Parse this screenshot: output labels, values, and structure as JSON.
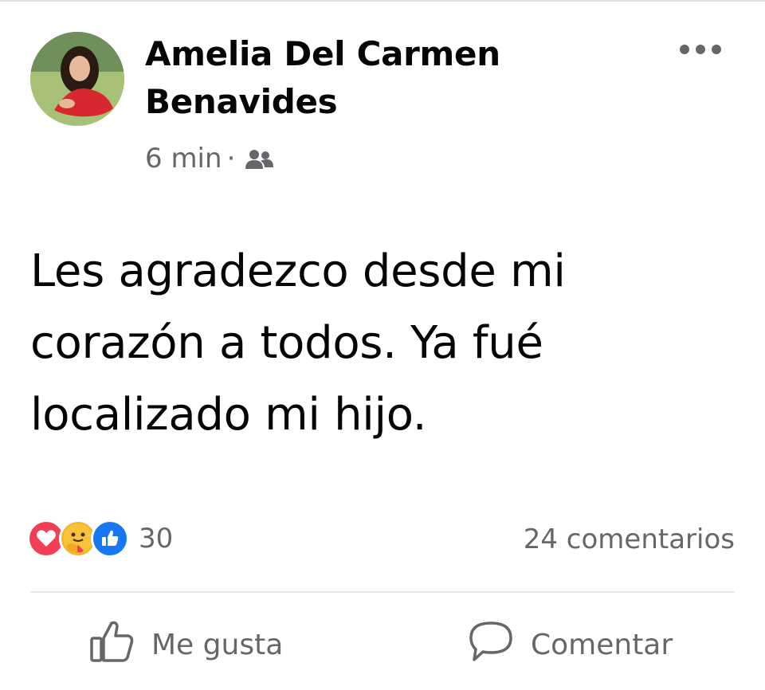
{
  "post": {
    "author": "Amelia Del Carmen Benavides",
    "time": "6 min",
    "separator": "·",
    "audience_icon": "friends-icon",
    "text": "Les agradezco desde mi corazón a todos. Ya fué localizado mi hijo."
  },
  "reactions": {
    "types": [
      "love",
      "care",
      "like"
    ],
    "count": "30"
  },
  "comments": {
    "count_label": "24 comentarios"
  },
  "actions": {
    "like_label": "Me gusta",
    "comment_label": "Comentar"
  },
  "colors": {
    "text_primary": "#050505",
    "text_secondary": "#65676b",
    "love": "#f33e58",
    "care": "#f7b125",
    "like": "#1877f2",
    "divider": "#e4e6eb"
  }
}
